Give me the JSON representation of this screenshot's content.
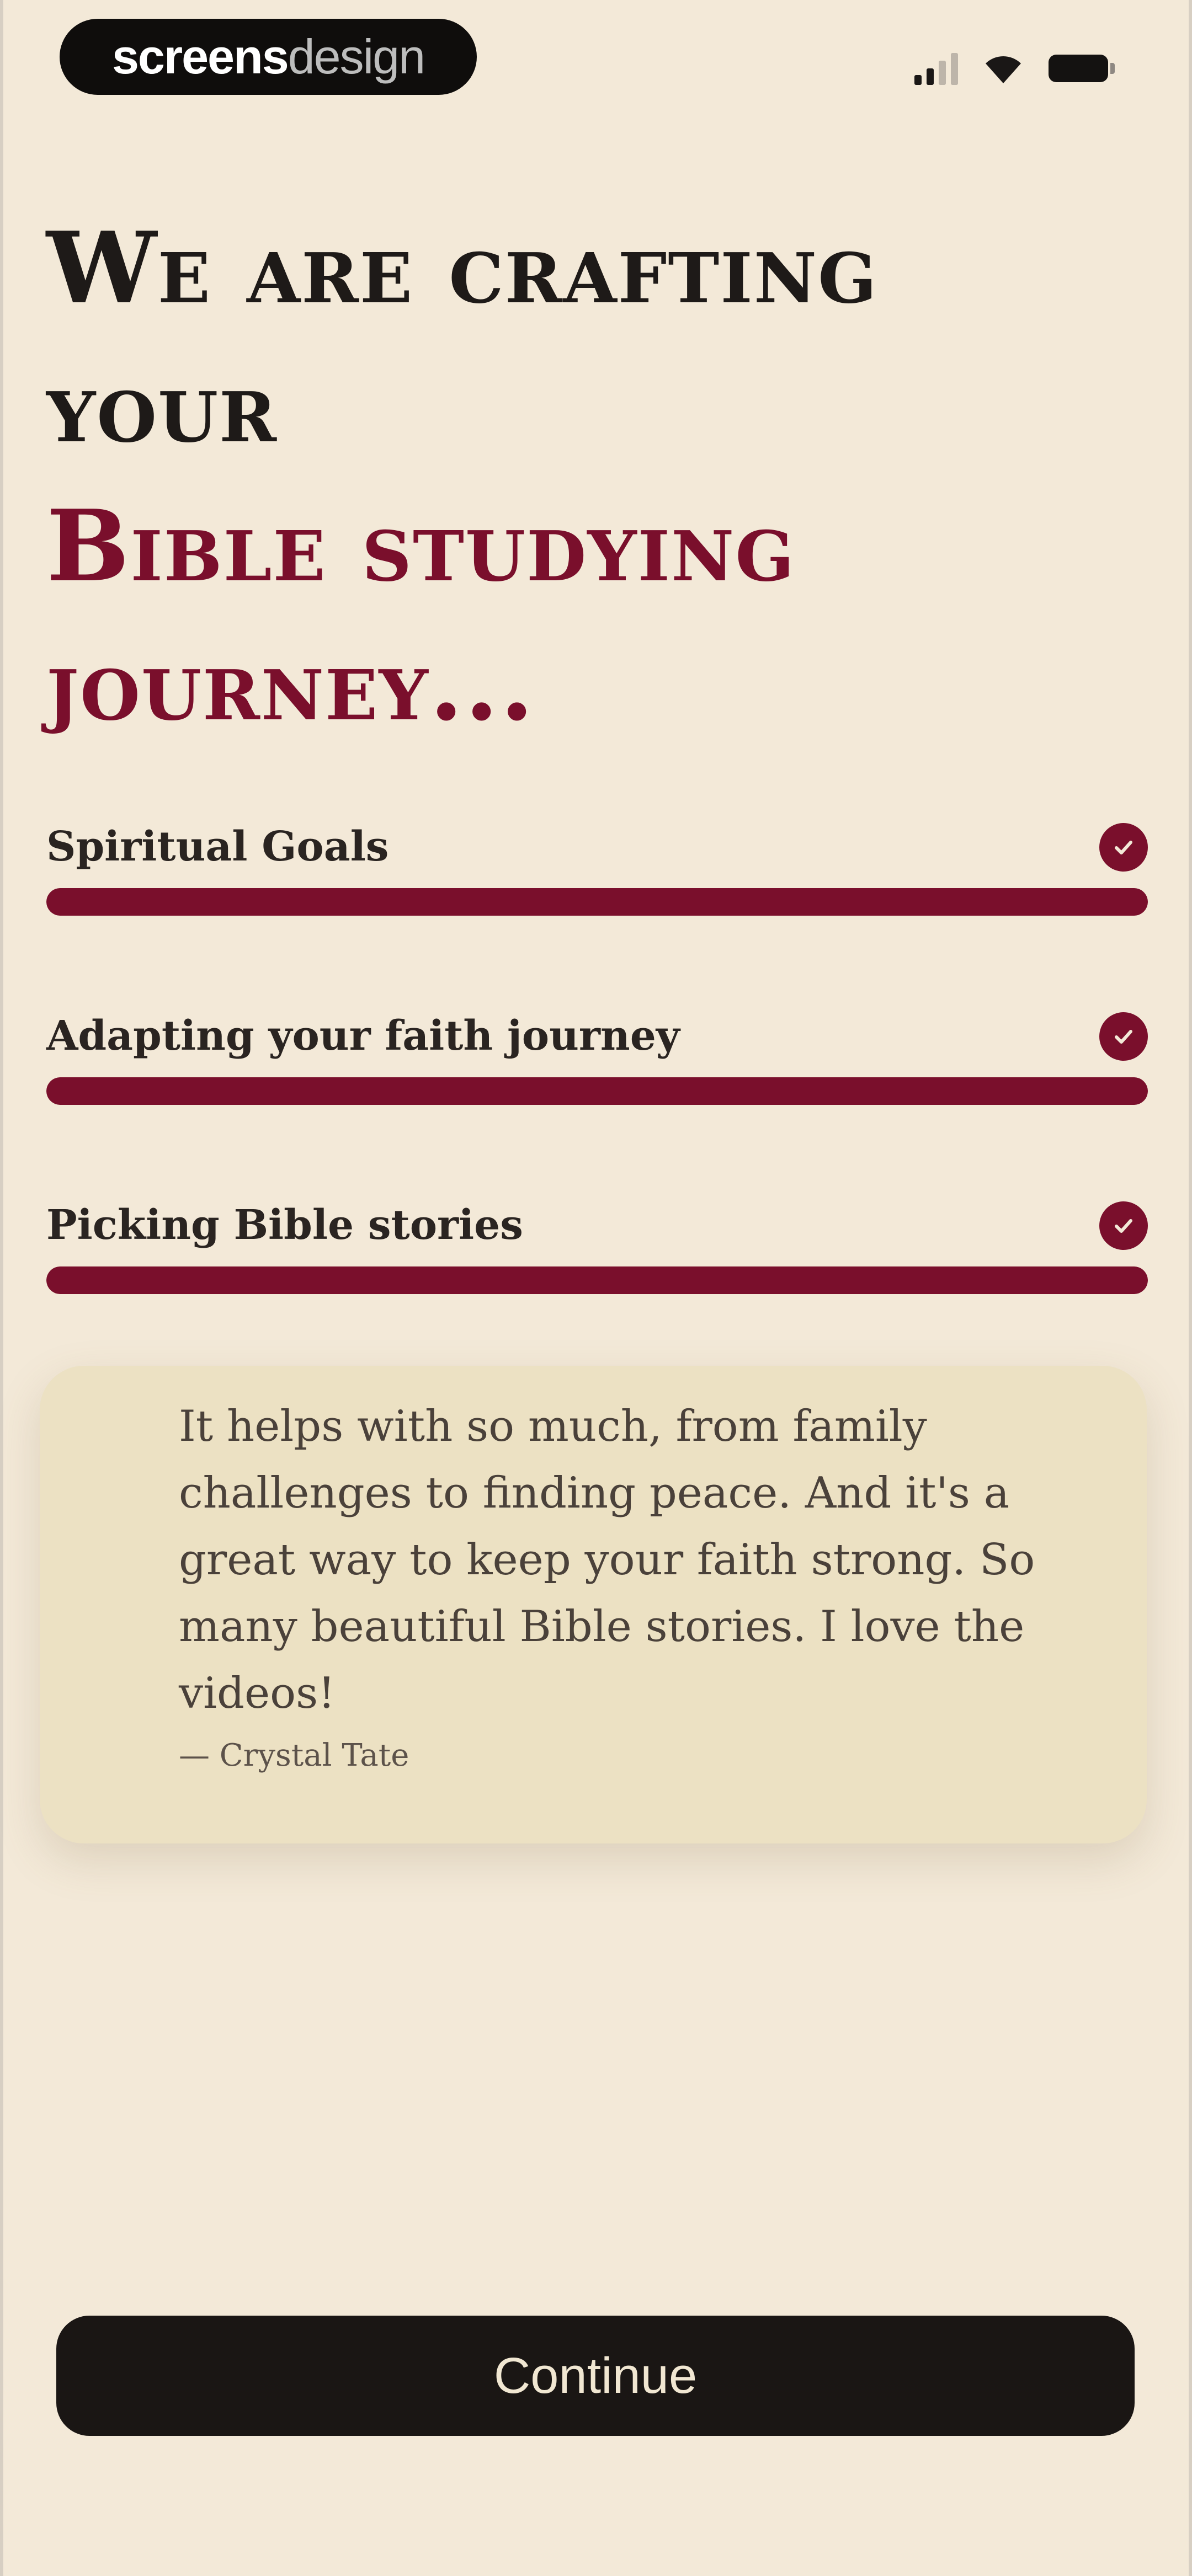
{
  "status_bar": {
    "brand_bold": "screens",
    "brand_light": "design",
    "icons": [
      "cellular-signal-icon",
      "wifi-icon",
      "battery-icon"
    ]
  },
  "heading": {
    "line1": "We are crafting",
    "line2": "your",
    "accent_line1": "Bible studying",
    "accent_line2": "journey..."
  },
  "progress": {
    "items": [
      {
        "label": "Spiritual Goals",
        "progress": 1.0,
        "completed": true
      },
      {
        "label": "Adapting your faith journey",
        "progress": 1.0,
        "completed": true
      },
      {
        "label": "Picking Bible stories",
        "progress": 1.0,
        "completed": true
      }
    ]
  },
  "testimonial": {
    "quote": "It helps with so much, from family challenges to finding peace. And it's a great way to keep your faith strong. So many beautiful Bible stories. I love the videos!",
    "author": "— Crystal Tate"
  },
  "continue_button": {
    "label": "Continue"
  },
  "colors": {
    "background": "#f3e9d8",
    "accent": "#7a0f2c",
    "text_dark": "#1e1a18",
    "card": "#ece1c3",
    "button": "#1a1614"
  }
}
